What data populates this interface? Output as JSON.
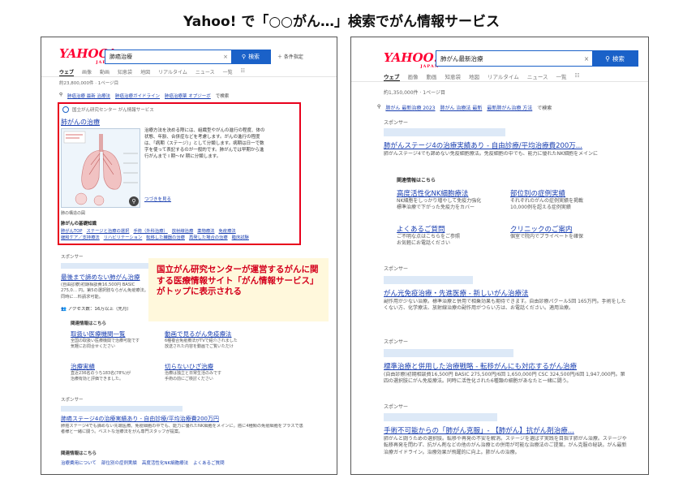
{
  "page_title": "Yahoo! で「○○がん…」検索でがん情報サービス",
  "left": {
    "logo": "YAHOO!",
    "logo_sub": "JAPAN",
    "query": "肺癌治療",
    "clear_icon": "×",
    "search_button": "検索",
    "advanced": "＋ 条件指定",
    "tabs": [
      "ウェブ",
      "画像",
      "動画",
      "知恵袋",
      "地図",
      "リアルタイム",
      "ニュース",
      "一覧"
    ],
    "filter_icon": "filter-icon",
    "result_count": "約23,800,000件 · 1ページ目",
    "related_searches": [
      "肺癌治療 最新 治療法",
      "肺癌治療ガイドライン",
      "肺癌治療薬 オプジーボ"
    ],
    "related_suffix": "で検索",
    "knowledge_panel": {
      "source": "国立がん研究センター がん情報サービス",
      "title": "肺がんの治療",
      "text": "治療方法を決める際には、組織型やがんの進行の程度、体の状態、年齢、合併症などを考慮します。がんの進行の程度は、「病期（ステージ）」として分類します。病期は日一で数字を使って表記するのが一般的です。肺がんでは早期から進行がんまで I 期〜IV 期に分類します。",
      "more": "つづきを見る",
      "caption": "肺の構造の図",
      "basic_heading": "肺がんの基礎知識",
      "links": [
        "肺がんTOP",
        "ステージと治療の選択",
        "手術（外科治療）",
        "放射線治療",
        "薬物療法",
        "免疫療法",
        "緩和ケア／支持療法",
        "リハビリテーション",
        "転移した臓器の治療",
        "再発した場合の治療",
        "臨床試験"
      ]
    },
    "callout": "国立がん研究センターが運営するがんに関する医療情報サイト「がん情報サービス」がトップに表示される",
    "sponsor_label": "スポンサー",
    "ad1": {
      "title": "最後まで諦めない肺がん治療",
      "desc": "(自由診療)初期相談費16,500円 BASIC 275,0… 円。第5の選択肢ならがん免疫療法。同時に…料請求可能。",
      "access": "アクセス数：16万以上（先月）",
      "related_heading": "関連情報はこちら",
      "sitelinks": [
        {
          "title": "取扱い医療機関一覧",
          "desc": "全国の取扱い医療機関で治療可能です\n気軽にお問合せください"
        },
        {
          "title": "動画で見るがん免疫療法",
          "desc": "6種複合免疫療法がTVで紹介されました\n放送された内容を動画でご覧いただけ"
        },
        {
          "title": "治療実績",
          "desc": "直近236名のうち183名(78%)が\n治療有効と評価できました。"
        },
        {
          "title": "切らないひざ治療",
          "desc": "治療は独立と日常生活のみです\n手術の前にご検討ください"
        }
      ]
    },
    "ad2": {
      "title": "肺癌ステージ4の治療実績あり - 自由診療/平均治療費200万円",
      "desc": "肺癌ステージ4でも諦めない先端医療。免疫細胞の中でも、能力に優れたNK細胞をメインに。癌に4種類の免疫細胞をプラスで患者様と一緒に闘う。ベストな治療法をがん専門スタッフが提案。",
      "related_heading": "関連情報はこちら",
      "links": [
        "治療費用について",
        "部位別の症例実績",
        "高度活性化NK細胞療法",
        "よくあるご質問"
      ]
    }
  },
  "right": {
    "logo": "YAHOO!",
    "logo_sub": "JAPAN",
    "query": "肺がん最新治療",
    "clear_icon": "×",
    "search_button": "検索",
    "tabs": [
      "ウェブ",
      "画像",
      "動画",
      "知恵袋",
      "地図",
      "リアルタイム",
      "ニュース",
      "一覧"
    ],
    "result_count": "約1,350,000件 · 1ページ目",
    "related_searches": [
      "肺がん 最新治療 2023",
      "肺がん 治療法 最新",
      "最新肺がん治療 方法"
    ],
    "related_suffix": "で検索",
    "sponsor_label": "スポンサー",
    "ad1": {
      "title": "肺がんステージ4の治療実績あり - 自由診療/平均治療費200万...",
      "desc": "肺がんステージ4でも諦めない免疫細胞療法。免疫細胞の中でも、能力に優れたNK細胞をメインに",
      "related_heading": "関連情報はこちら",
      "sitelinks": [
        {
          "title": "高度活性化NK細胞療法",
          "desc": "NK細胞をしっかり増やして免疫力強化\n標準治療で下がった免疫力をカバー"
        },
        {
          "title": "部位別の症例実績",
          "desc": "それぞれのがんの症例実績を掲載\n10,000例を超える症例実績"
        },
        {
          "title": "よくあるご質問",
          "desc": "ご不明な点はこちらをご参照\nお気軽にお電話ください"
        },
        {
          "title": "クリニックのご案内",
          "desc": "個室で院内でプライベートを確保\n"
        }
      ]
    },
    "ad2": {
      "title": "がん光免疫治療・先進医療 - 新しいがん治療法",
      "desc": "副作用が少ない治療。標準治療と併用で相乗効果も期待できます。自由診療パクール5回 165万円。手術をしたくない方、化学療法、放射線治療の副作用がつらい方は、お電話ください。適用治療。"
    },
    "ad3": {
      "title": "標準治療と併用した治療戦略 - 転移がんにも対応するがん治療",
      "desc": "(自由診療)初期相談費16,500円 BASIC 275,500円/6回 1,650,000円 CSC 324,500円/6回 1,947,000円。第四の選択肢にがん免疫療法。同時に活性化された6種類の細胞があなたと一緒に闘う。"
    },
    "ad4": {
      "title": "手術不可能からの「肺がん克服」- 【肺がん】抗がん剤治療...",
      "desc": "肺がんと闘うための選択肢。転移や再発の不安を解消。ステージを選ばず実践を目指す肺がん治療。ステージや転移再発を問わず、抗がん剤などの他のがん治療との併用が可能な治療法のご提案。がん克服の秘訣。がん最新治療ガイドライン。治療効果が飛躍的に向上。肺がんの治療。"
    }
  }
}
